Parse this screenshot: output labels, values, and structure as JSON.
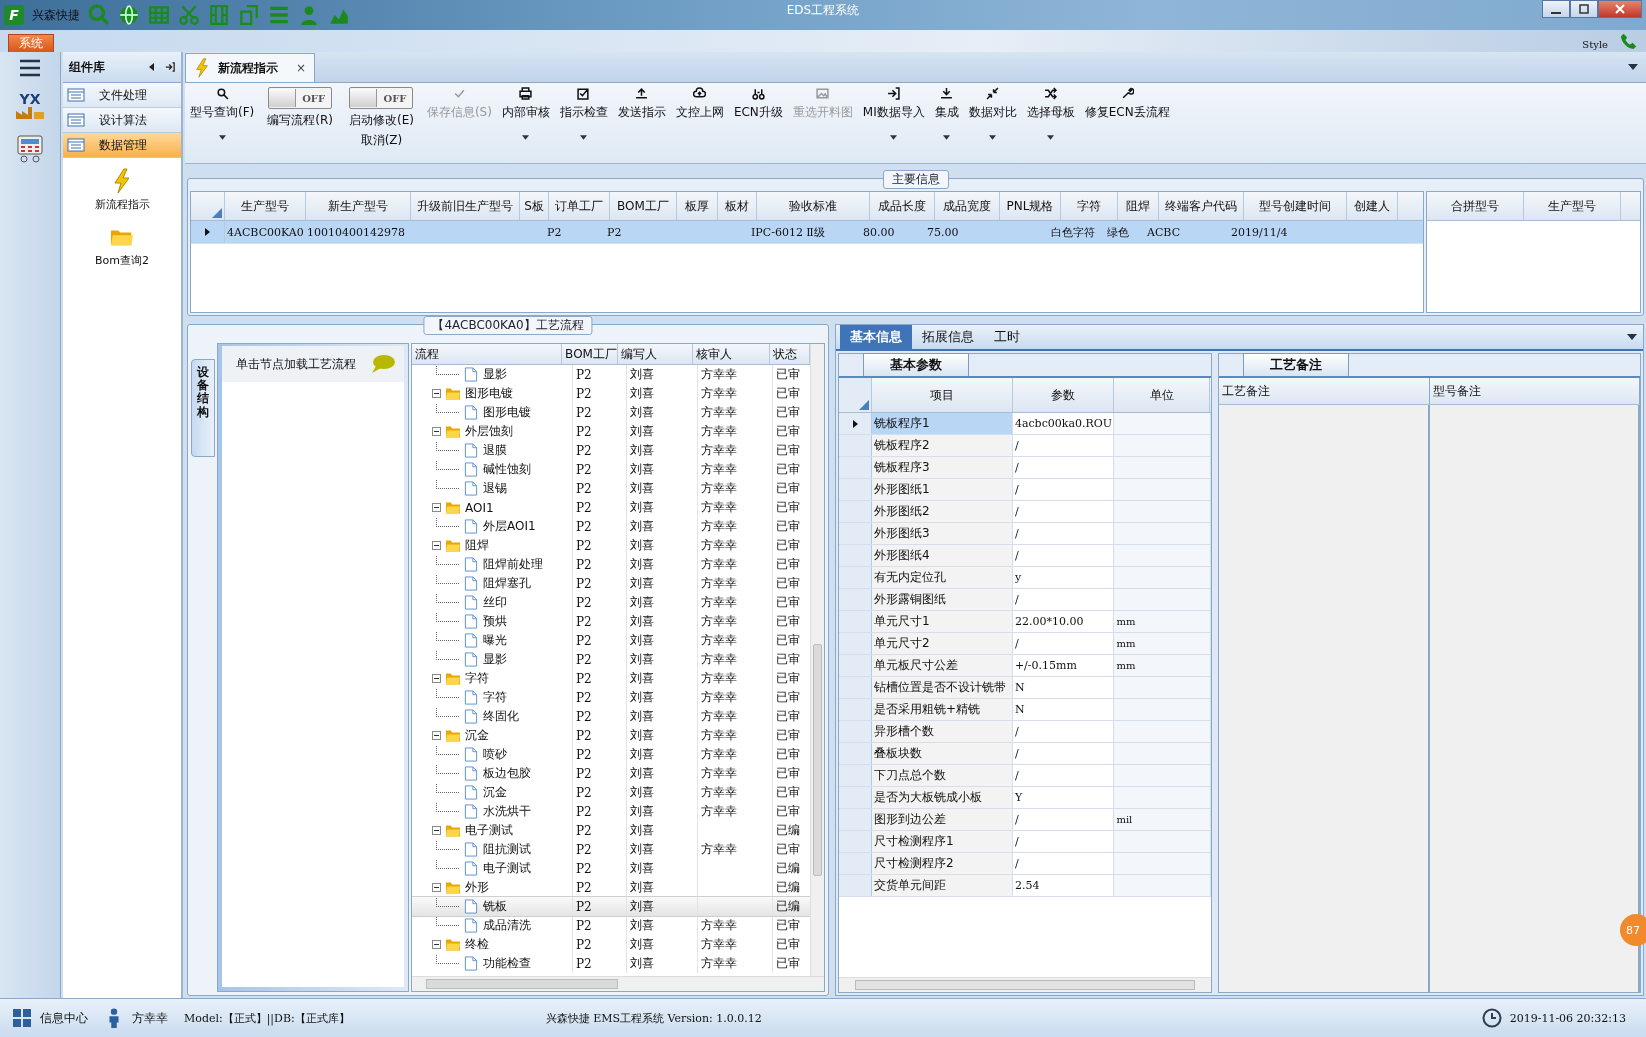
{
  "window": {
    "logo": "F",
    "app_name": "兴森快捷",
    "title": "EDS工程系统"
  },
  "menu_bar": {
    "tab": "系统",
    "style_label": "Style"
  },
  "left_strip": {
    "logo_text": "YX"
  },
  "sidebar": {
    "title": "组件库",
    "items": [
      {
        "label": "文件处理",
        "selected": false
      },
      {
        "label": "设计算法",
        "selected": false
      },
      {
        "label": "数据管理",
        "selected": true
      }
    ],
    "shortcuts": [
      {
        "label": "新流程指示",
        "kind": "bolt"
      },
      {
        "label": "Bom查询2",
        "kind": "folder"
      }
    ]
  },
  "document_tab": {
    "label": "新流程指示",
    "close": "×"
  },
  "toolbar": [
    {
      "label": "型号查询(F)",
      "kind": "button",
      "dropdown": true,
      "disabled": false
    },
    {
      "label": "编写流程(R)",
      "kind": "toggle",
      "toggle_text": "OFF",
      "on": false
    },
    {
      "label": "启动修改(E)",
      "sublabel": "取消(Z)",
      "kind": "toggle",
      "toggle_text": "OFF",
      "on": false
    },
    {
      "label": "保存信息(S)",
      "kind": "button",
      "dropdown": false,
      "disabled": true
    },
    {
      "label": "内部审核",
      "kind": "button",
      "dropdown": true,
      "disabled": false
    },
    {
      "label": "指示检查",
      "kind": "button",
      "dropdown": true,
      "disabled": false
    },
    {
      "label": "发送指示",
      "kind": "button",
      "dropdown": false,
      "disabled": false
    },
    {
      "label": "文控上网",
      "kind": "button",
      "dropdown": false,
      "disabled": false
    },
    {
      "label": "ECN升级",
      "kind": "button",
      "dropdown": false,
      "disabled": false
    },
    {
      "label": "重选开料图",
      "kind": "button",
      "dropdown": false,
      "disabled": true
    },
    {
      "label": "MI数据导入",
      "kind": "button",
      "dropdown": true,
      "disabled": false
    },
    {
      "label": "集成",
      "kind": "button",
      "dropdown": true,
      "disabled": false
    },
    {
      "label": "数据对比",
      "kind": "button",
      "dropdown": true,
      "disabled": false
    },
    {
      "label": "选择母板",
      "kind": "button",
      "dropdown": true,
      "disabled": false
    },
    {
      "label": "修复ECN丢流程",
      "kind": "button",
      "dropdown": false,
      "disabled": false
    }
  ],
  "main_info": {
    "legend": "主要信息",
    "columns": [
      "生产型号",
      "新生产型号",
      "升级前旧生产型号",
      "S板",
      "订单工厂",
      "BOM工厂",
      "板厚",
      "板材",
      "验收标准",
      "成品长度",
      "成品宽度",
      "PNL规格",
      "字符",
      "阻焊",
      "终端客户代码",
      "型号创建时间",
      "创建人"
    ],
    "rows": [
      {
        "selected": true,
        "cells": [
          "4ACBC00KA0",
          "10010400142978",
          null,
          null,
          "P2",
          "P2",
          null,
          null,
          "IPC-6012 Ⅱ级",
          "80.00",
          "75.00",
          null,
          "白色字符",
          "绿色",
          "ACBC",
          "2019/11/4",
          null
        ]
      }
    ],
    "side_columns": [
      "合拼型号",
      "生产型号"
    ]
  },
  "flow": {
    "legend": "【4ACBC00KA0】工艺流程",
    "side_tab": "设备结构",
    "hint": "单击节点加载工艺流程",
    "columns": [
      "流程",
      "BOM工厂",
      "编写人",
      "核审人",
      "状态"
    ],
    "rows": [
      {
        "name": "显影",
        "kind": "file",
        "bom": "P2",
        "writer": "刘喜",
        "reviewer": "方幸幸",
        "status": "已审",
        "selected": false
      },
      {
        "name": "图形电镀",
        "kind": "folder",
        "expanded": true,
        "bom": "P2",
        "writer": "刘喜",
        "reviewer": "方幸幸",
        "status": "已审",
        "selected": false,
        "children": [
          {
            "name": "图形电镀",
            "kind": "file",
            "bom": "P2",
            "writer": "刘喜",
            "reviewer": "方幸幸",
            "status": "已审",
            "selected": false
          }
        ]
      },
      {
        "name": "外层蚀刻",
        "kind": "folder",
        "expanded": true,
        "bom": "P2",
        "writer": "刘喜",
        "reviewer": "方幸幸",
        "status": "已审",
        "selected": false,
        "children": [
          {
            "name": "退膜",
            "kind": "file",
            "bom": "P2",
            "writer": "刘喜",
            "reviewer": "方幸幸",
            "status": "已审",
            "selected": false
          },
          {
            "name": "碱性蚀刻",
            "kind": "file",
            "bom": "P2",
            "writer": "刘喜",
            "reviewer": "方幸幸",
            "status": "已审",
            "selected": false
          },
          {
            "name": "退锡",
            "kind": "file",
            "bom": "P2",
            "writer": "刘喜",
            "reviewer": "方幸幸",
            "status": "已审",
            "selected": false
          }
        ]
      },
      {
        "name": "AOI1",
        "kind": "folder",
        "expanded": true,
        "bom": "P2",
        "writer": "刘喜",
        "reviewer": "方幸幸",
        "status": "已审",
        "selected": false,
        "children": [
          {
            "name": "外层AOI1",
            "kind": "file",
            "bom": "P2",
            "writer": "刘喜",
            "reviewer": "方幸幸",
            "status": "已审",
            "selected": false
          }
        ]
      },
      {
        "name": "阻焊",
        "kind": "folder",
        "expanded": true,
        "bom": "P2",
        "writer": "刘喜",
        "reviewer": "方幸幸",
        "status": "已审",
        "selected": false,
        "children": [
          {
            "name": "阻焊前处理",
            "kind": "file",
            "bom": "P2",
            "writer": "刘喜",
            "reviewer": "方幸幸",
            "status": "已审",
            "selected": false
          },
          {
            "name": "阻焊塞孔",
            "kind": "file",
            "bom": "P2",
            "writer": "刘喜",
            "reviewer": "方幸幸",
            "status": "已审",
            "selected": false
          },
          {
            "name": "丝印",
            "kind": "file",
            "bom": "P2",
            "writer": "刘喜",
            "reviewer": "方幸幸",
            "status": "已审",
            "selected": false
          },
          {
            "name": "预烘",
            "kind": "file",
            "bom": "P2",
            "writer": "刘喜",
            "reviewer": "方幸幸",
            "status": "已审",
            "selected": false
          },
          {
            "name": "曝光",
            "kind": "file",
            "bom": "P2",
            "writer": "刘喜",
            "reviewer": "方幸幸",
            "status": "已审",
            "selected": false
          },
          {
            "name": "显影",
            "kind": "file",
            "bom": "P2",
            "writer": "刘喜",
            "reviewer": "方幸幸",
            "status": "已审",
            "selected": false
          }
        ]
      },
      {
        "name": "字符",
        "kind": "folder",
        "expanded": true,
        "bom": "P2",
        "writer": "刘喜",
        "reviewer": "方幸幸",
        "status": "已审",
        "selected": false,
        "children": [
          {
            "name": "字符",
            "kind": "file",
            "bom": "P2",
            "writer": "刘喜",
            "reviewer": "方幸幸",
            "status": "已审",
            "selected": false
          },
          {
            "name": "终固化",
            "kind": "file",
            "bom": "P2",
            "writer": "刘喜",
            "reviewer": "方幸幸",
            "status": "已审",
            "selected": false
          }
        ]
      },
      {
        "name": "沉金",
        "kind": "folder",
        "expanded": true,
        "bom": "P2",
        "writer": "刘喜",
        "reviewer": "方幸幸",
        "status": "已审",
        "selected": false,
        "children": [
          {
            "name": "喷砂",
            "kind": "file",
            "bom": "P2",
            "writer": "刘喜",
            "reviewer": "方幸幸",
            "status": "已审",
            "selected": false
          },
          {
            "name": "板边包胶",
            "kind": "file",
            "bom": "P2",
            "writer": "刘喜",
            "reviewer": "方幸幸",
            "status": "已审",
            "selected": false
          },
          {
            "name": "沉金",
            "kind": "file",
            "bom": "P2",
            "writer": "刘喜",
            "reviewer": "方幸幸",
            "status": "已审",
            "selected": false
          },
          {
            "name": "水洗烘干",
            "kind": "file",
            "bom": "P2",
            "writer": "刘喜",
            "reviewer": "方幸幸",
            "status": "已审",
            "selected": false
          }
        ]
      },
      {
        "name": "电子测试",
        "kind": "folder",
        "expanded": true,
        "bom": "P2",
        "writer": "刘喜",
        "status": "已编",
        "selected": false,
        "children": [
          {
            "name": "阻抗测试",
            "kind": "file",
            "bom": "P2",
            "writer": "刘喜",
            "reviewer": "方幸幸",
            "status": "已审",
            "selected": false
          },
          {
            "name": "电子测试",
            "kind": "file",
            "bom": "P2",
            "writer": "刘喜",
            "status": "已编",
            "selected": false
          }
        ]
      },
      {
        "name": "外形",
        "kind": "folder",
        "expanded": true,
        "bom": "P2",
        "writer": "刘喜",
        "status": "已编",
        "selected": false,
        "children": [
          {
            "name": "铣板",
            "kind": "file",
            "bom": "P2",
            "writer": "刘喜",
            "status": "已编",
            "selected": true
          },
          {
            "name": "成品清洗",
            "kind": "file",
            "bom": "P2",
            "writer": "刘喜",
            "reviewer": "方幸幸",
            "status": "已审",
            "selected": false
          }
        ]
      },
      {
        "name": "终检",
        "kind": "folder",
        "expanded": true,
        "bom": "P2",
        "writer": "刘喜",
        "reviewer": "方幸幸",
        "status": "已审",
        "selected": false,
        "children": [
          {
            "name": "功能检查",
            "kind": "file",
            "bom": "P2",
            "writer": "刘喜",
            "reviewer": "方幸幸",
            "status": "已审",
            "selected": false
          }
        ]
      }
    ]
  },
  "detail_tabs": [
    {
      "label": "基本信息",
      "selected": true
    },
    {
      "label": "拓展信息",
      "selected": false
    },
    {
      "label": "工时",
      "selected": false
    }
  ],
  "params": {
    "tab": "基本参数",
    "columns": [
      "项目",
      "参数",
      "单位"
    ],
    "rows": [
      {
        "name": "铣板程序1",
        "value": "4acbc00ka0.ROU",
        "selected": true
      },
      {
        "name": "铣板程序2",
        "value": "/",
        "selected": false
      },
      {
        "name": "铣板程序3",
        "value": "/",
        "selected": false
      },
      {
        "name": "外形图纸1",
        "value": "/",
        "selected": false
      },
      {
        "name": "外形图纸2",
        "value": "/",
        "selected": false
      },
      {
        "name": "外形图纸3",
        "value": "/",
        "selected": false
      },
      {
        "name": "外形图纸4",
        "value": "/",
        "selected": false
      },
      {
        "name": "有无内定位孔",
        "value": "y",
        "selected": false
      },
      {
        "name": "外形露铜图纸",
        "value": "/",
        "selected": false
      },
      {
        "name": "单元尺寸1",
        "value": "22.00*10.00",
        "unit": "mm",
        "selected": false
      },
      {
        "name": "单元尺寸2",
        "value": "/",
        "unit": "mm",
        "selected": false
      },
      {
        "name": "单元板尺寸公差",
        "value": "+/-0.15mm",
        "unit": "mm",
        "selected": false
      },
      {
        "name": "钻槽位置是否不设计铣带",
        "value": "N",
        "selected": false
      },
      {
        "name": "是否采用粗铣+精铣",
        "value": "N",
        "selected": false
      },
      {
        "name": "异形槽个数",
        "value": "/",
        "selected": false
      },
      {
        "name": "叠板块数",
        "value": "/",
        "selected": false
      },
      {
        "name": "下刀点总个数",
        "value": "/",
        "selected": false
      },
      {
        "name": "是否为大板铣成小板",
        "value": "Y",
        "selected": false
      },
      {
        "name": "图形到边公差",
        "value": "/",
        "unit": "mil",
        "selected": false
      },
      {
        "name": "尺寸检测程序1",
        "value": "/",
        "selected": false
      },
      {
        "name": "尺寸检测程序2",
        "value": "/",
        "selected": false
      },
      {
        "name": "交货单元间距",
        "value": "2.54",
        "selected": false
      }
    ]
  },
  "notes": {
    "tab": "工艺备注",
    "columns": [
      "工艺备注",
      "型号备注"
    ]
  },
  "badge": "87",
  "status_bar": {
    "info_center": "信息中心",
    "user": "方幸幸",
    "model": "Model:【正式】||DB:【正式库】",
    "version": "兴森快捷 EMS工程系统 Version: 1.0.0.12",
    "datetime": "2019-11-06 20:32:13"
  }
}
